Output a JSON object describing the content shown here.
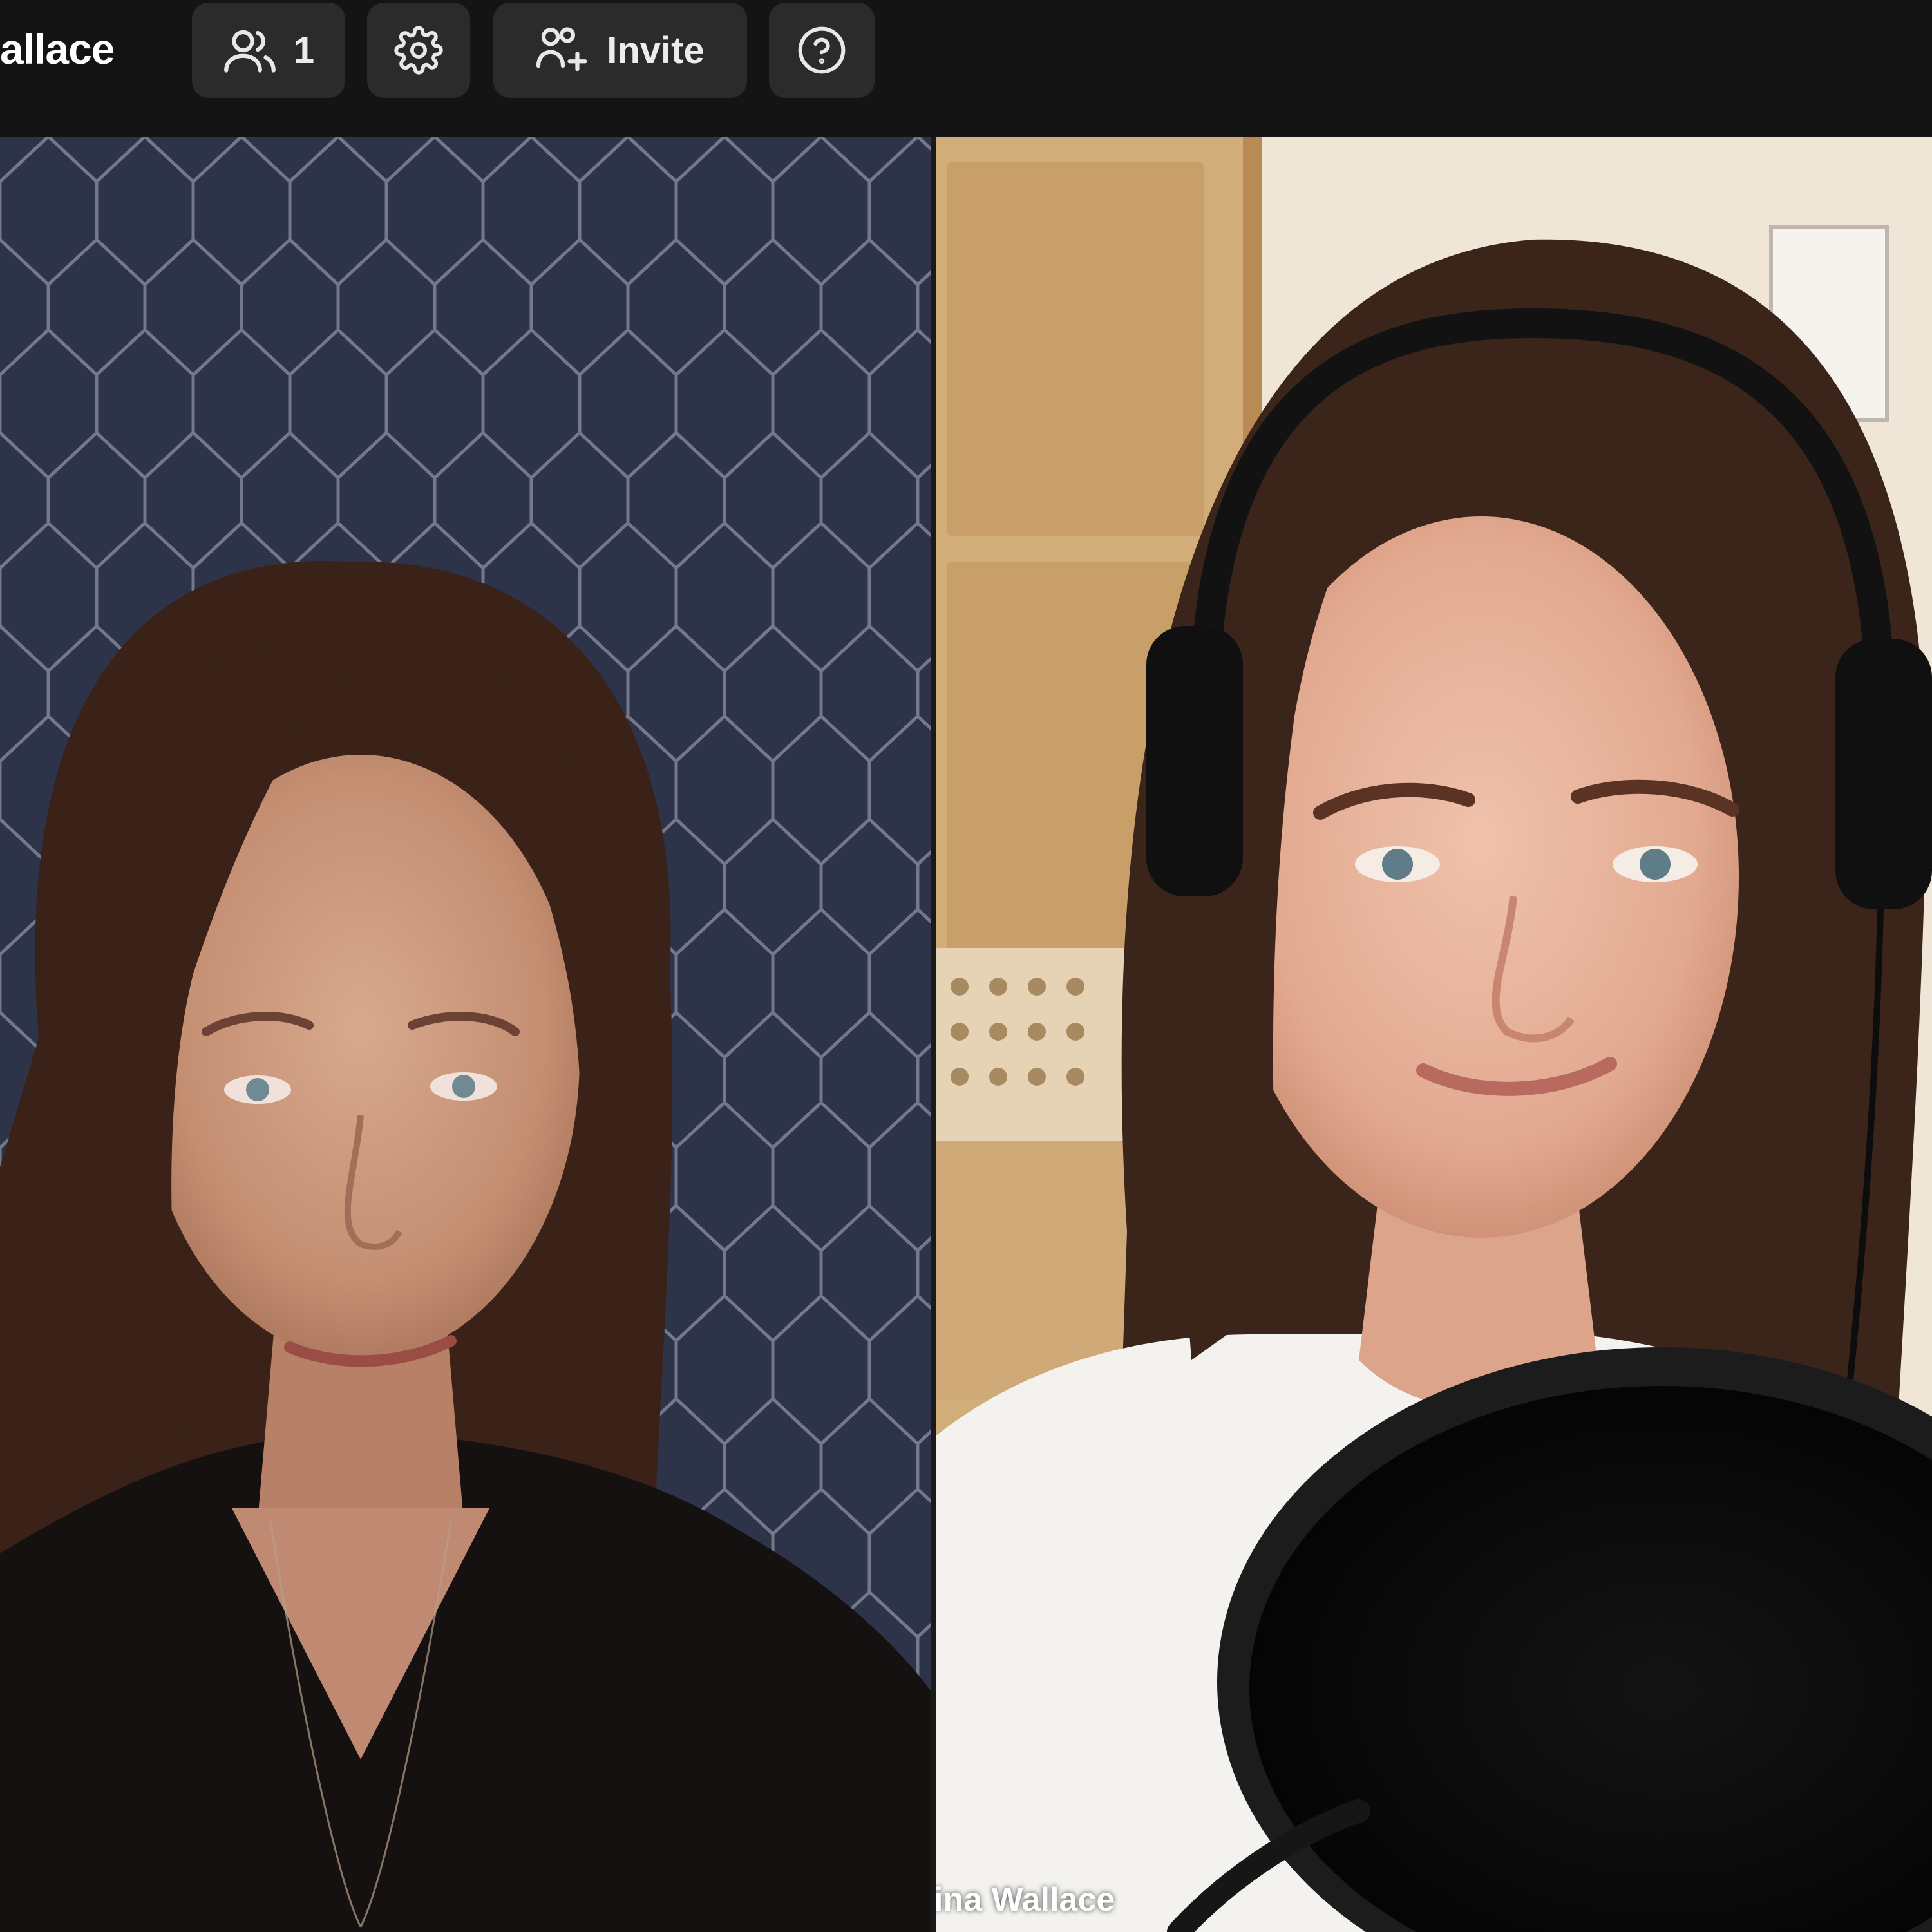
{
  "topbar": {
    "title": "allace",
    "participants_count": "1",
    "invite_label": "Invite",
    "icons": {
      "participants": "users-icon",
      "settings": "gear-icon",
      "invite": "user-plus-icon",
      "help": "question-circle-icon"
    }
  },
  "videos": [
    {
      "participant_label": ""
    },
    {
      "participant_label": "ina Wallace"
    }
  ],
  "colors": {
    "topbar_bg": "#141414",
    "button_bg": "#2b2b2b",
    "text": "#ffffff"
  }
}
